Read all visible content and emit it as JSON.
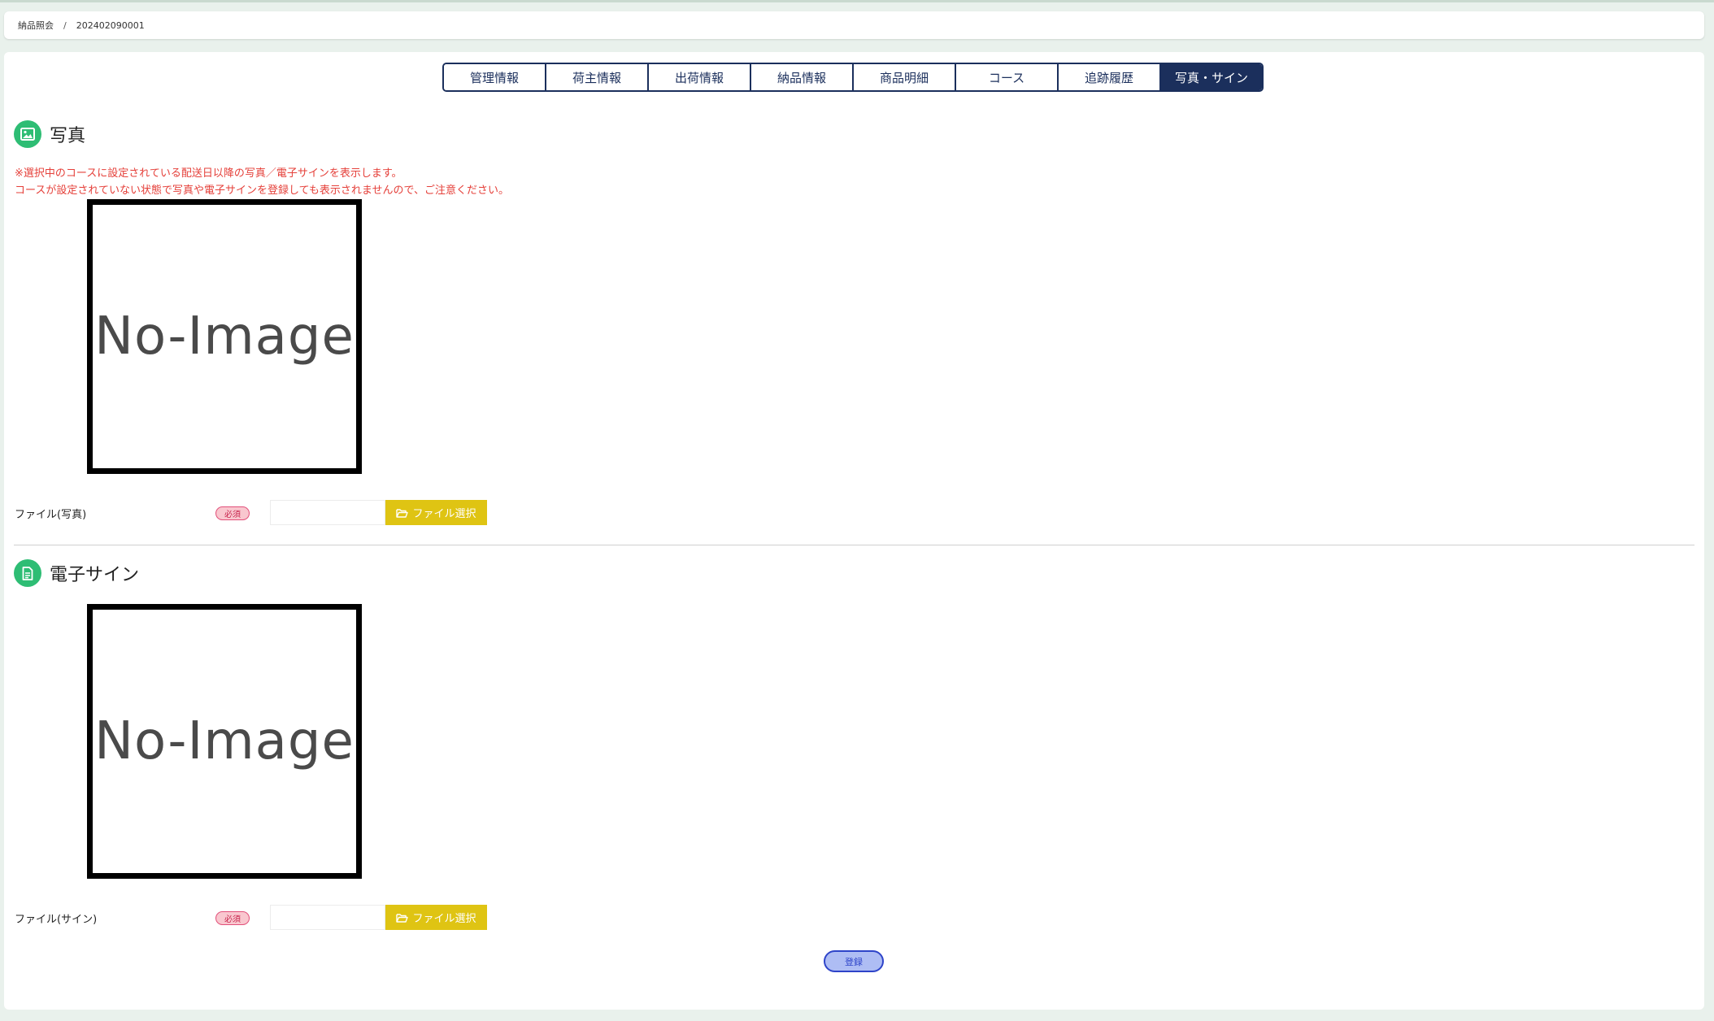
{
  "breadcrumb": {
    "parent": "納品照会",
    "separator": "/",
    "current": "202402090001"
  },
  "tabs": [
    {
      "label": "管理情報",
      "active": false
    },
    {
      "label": "荷主情報",
      "active": false
    },
    {
      "label": "出荷情報",
      "active": false
    },
    {
      "label": "納品情報",
      "active": false
    },
    {
      "label": "商品明細",
      "active": false
    },
    {
      "label": "コース",
      "active": false
    },
    {
      "label": "追跡履歴",
      "active": false
    },
    {
      "label": "写真・サイン",
      "active": true
    }
  ],
  "photo_section": {
    "title": "写真",
    "icon": "image-icon",
    "notice_line1": "※選択中のコースに設定されている配送日以降の写真／電子サインを表示します。",
    "notice_line2": "コースが設定されていない状態で写真や電子サインを登録しても表示されませんので、ご注意ください。",
    "placeholder_text": "No-Image",
    "file_label": "ファイル(写真)",
    "required_badge": "必須",
    "file_button": "ファイル選択"
  },
  "sign_section": {
    "title": "電子サイン",
    "icon": "document-icon",
    "placeholder_text": "No-Image",
    "file_label": "ファイル(サイン)",
    "required_badge": "必須",
    "file_button": "ファイル選択"
  },
  "submit": {
    "label": "登録"
  },
  "colors": {
    "accent": "#1b2f5c",
    "section_icon": "#2ebd74",
    "notice": "#e5403a",
    "file_button": "#dfc413",
    "submit_button": "#aebdf4"
  }
}
